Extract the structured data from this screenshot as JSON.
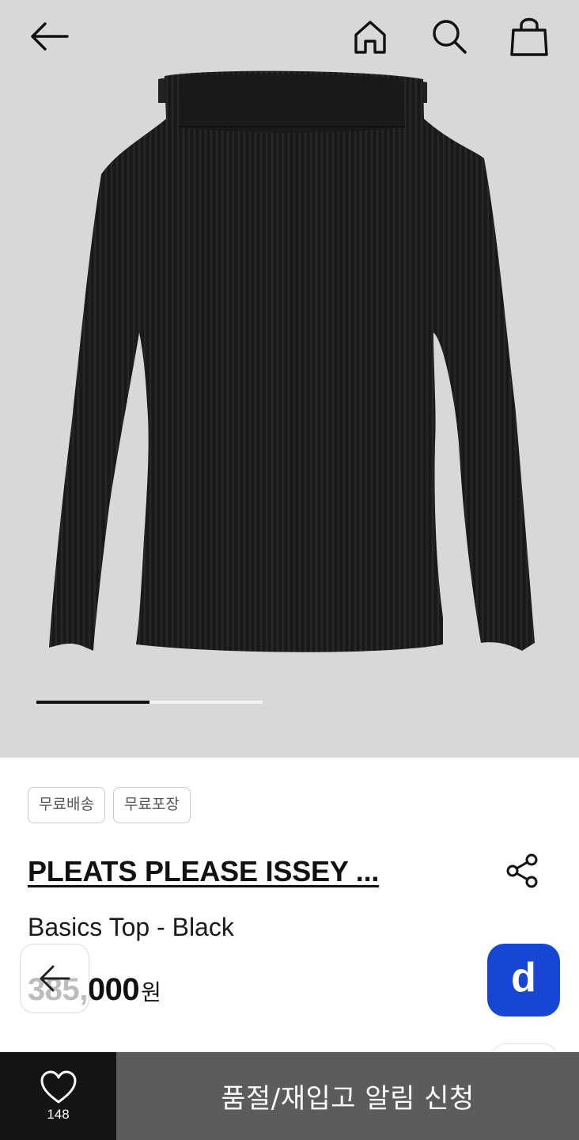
{
  "header": {
    "back_icon": "arrow-left-icon",
    "home_icon": "home-icon",
    "search_icon": "search-icon",
    "cart_icon": "shopping-bag-icon"
  },
  "gallery": {
    "image_description_icon": "product-photo",
    "progress_fraction": 0.5
  },
  "product": {
    "badges": [
      "무료배송",
      "무료포장"
    ],
    "brand": "PLEATS PLEASE ISSEY ...",
    "name": "Basics Top - Black",
    "price": "385,000",
    "currency": "원"
  },
  "floating": {
    "back_icon": "arrow-left-icon",
    "d_button_label": "d",
    "d_button_color": "#1746d4"
  },
  "bottom_bar": {
    "like_count": "148",
    "cta_label": "품절/재입고 알림 신청"
  },
  "colors": {
    "hero_bg": "#d8d8d8",
    "like_bg": "#141414",
    "cta_bg": "#5c5c5c"
  }
}
